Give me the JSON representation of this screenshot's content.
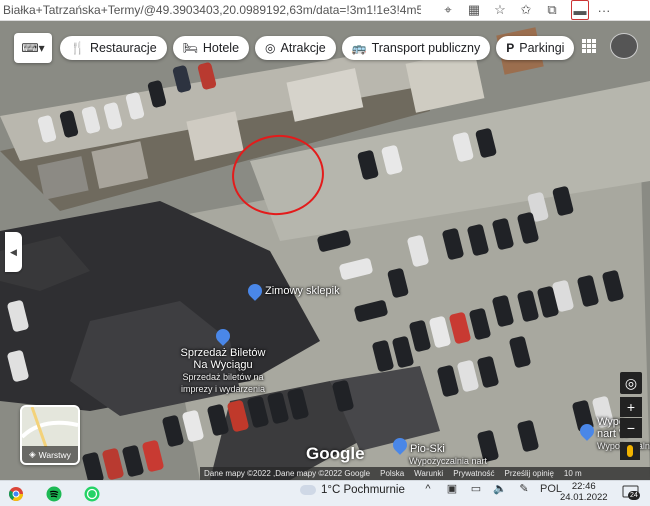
{
  "browser": {
    "url": "Białka+Tatrzańska+Termy/@49.3903403,20.0989192,63m/data=!3m1!1e3!4m5!3m4!1s0x",
    "icons": [
      "location-icon",
      "grid-icon",
      "star-icon",
      "favorites-icon",
      "collections-icon",
      "extension-icon",
      "more-icon"
    ]
  },
  "map": {
    "chips": [
      {
        "label": "Restauracje",
        "icon": "fork-knife-icon"
      },
      {
        "label": "Hotele",
        "icon": "bed-icon"
      },
      {
        "label": "Atrakcje",
        "icon": "camera-icon"
      },
      {
        "label": "Transport publiczny",
        "icon": "bus-icon"
      },
      {
        "label": "Parkingi",
        "icon": "parking-icon"
      }
    ],
    "places": {
      "shop": "Zimowy sklepik",
      "tickets_1": "Sprzedaż Biletów",
      "tickets_2": "Na Wyciągu",
      "tickets_sub_1": "Sprzedaż biletów na",
      "tickets_sub_2": "imprezy i wydarzenia",
      "pioski": "Pio-Ski",
      "pioski_sub": "Wypożyczalnia nart",
      "wypo_1": "Wypo",
      "wypo_2": "nart W",
      "wypo_sub": "Wypożyczalni"
    },
    "layers_label": "Warstwy",
    "logo": "Google",
    "footer": {
      "data": "Dane mapy ©2022 ,Dane mapy ©2022 Google",
      "country": "Polska",
      "terms": "Warunki",
      "privacy": "Prywatność",
      "feedback": "Prześlij opinię",
      "scale": "10 m"
    },
    "accent": "#e31b1b"
  },
  "taskbar": {
    "apps": [
      "chrome-icon",
      "spotify-icon",
      "whatsapp-icon"
    ],
    "weather": "1°C  Pochmurnie",
    "lang": "POL",
    "time": "22:46",
    "date": "24.01.2022",
    "notifications": "24"
  }
}
